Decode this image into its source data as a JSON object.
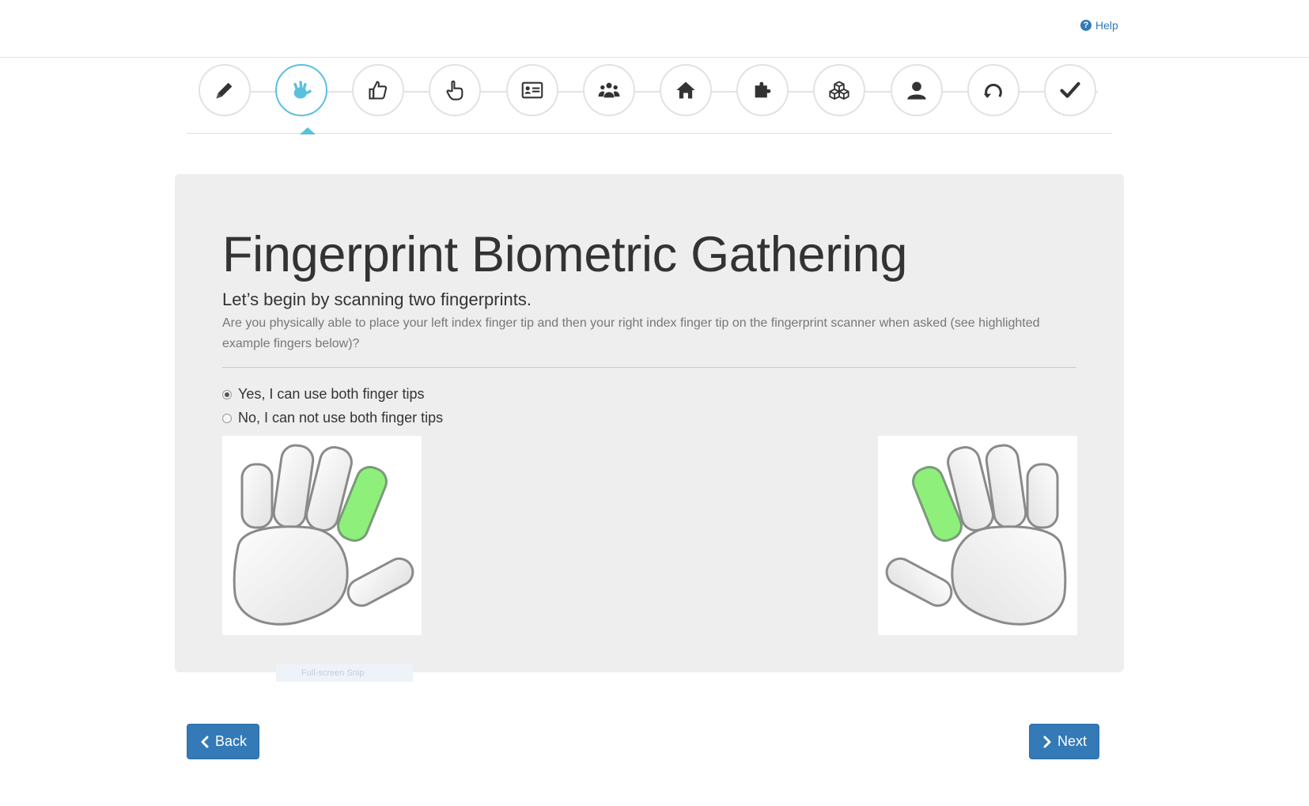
{
  "header": {
    "help_label": "Help",
    "help_icon": "question-circle-icon"
  },
  "steps": [
    {
      "name": "edit",
      "icon": "pencil-icon",
      "active": false
    },
    {
      "name": "fingerprint",
      "icon": "hand-icon",
      "active": true
    },
    {
      "name": "thumb",
      "icon": "thumbs-up-icon",
      "active": false
    },
    {
      "name": "point",
      "icon": "hand-pointer-icon",
      "active": false
    },
    {
      "name": "id-card",
      "icon": "id-card-icon",
      "active": false
    },
    {
      "name": "family",
      "icon": "users-icon",
      "active": false
    },
    {
      "name": "home",
      "icon": "home-icon",
      "active": false
    },
    {
      "name": "puzzle",
      "icon": "puzzle-icon",
      "active": false
    },
    {
      "name": "cubes",
      "icon": "cubes-icon",
      "active": false
    },
    {
      "name": "person",
      "icon": "user-icon",
      "active": false
    },
    {
      "name": "refresh",
      "icon": "undo-icon",
      "active": false
    },
    {
      "name": "done",
      "icon": "check-icon",
      "active": false
    }
  ],
  "main": {
    "title": "Fingerprint Biometric Gathering",
    "subtitle": "Let’s begin by scanning two fingerprints.",
    "question": "Are you physically able to place your left index finger tip and then your right index finger tip on the fingerprint scanner when asked (see highlighted example fingers below)?",
    "options": [
      {
        "label": "Yes, I can use both finger tips",
        "selected": true
      },
      {
        "label": "No, I can not use both finger tips",
        "selected": false
      }
    ],
    "hands": {
      "left_highlight": "index finger",
      "right_highlight": "index finger",
      "highlight_color": "#8ef07a"
    }
  },
  "overlay": {
    "snip_text": "Full-screen Snip"
  },
  "footer": {
    "back_label": "Back",
    "next_label": "Next"
  },
  "colors": {
    "accent": "#5bc0de",
    "primary": "#337ab7",
    "panel_bg": "#eeeeee"
  }
}
